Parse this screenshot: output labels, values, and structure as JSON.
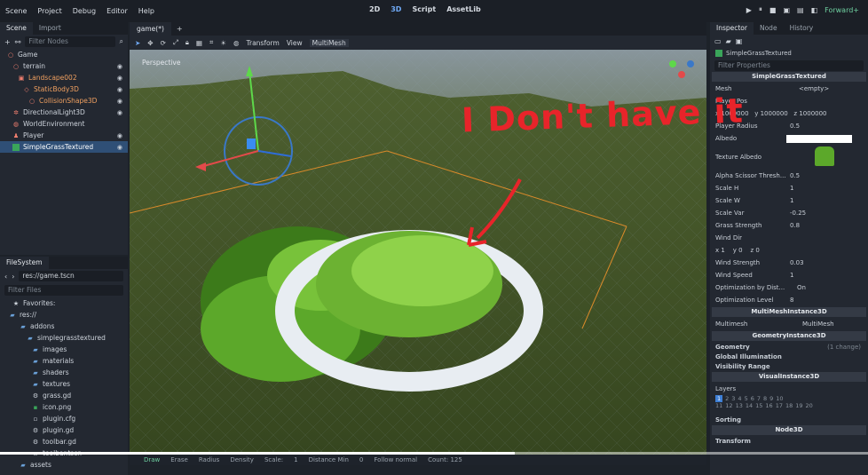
{
  "menu": [
    "Scene",
    "Project",
    "Debug",
    "Editor",
    "Help"
  ],
  "center_tabs": [
    "2D",
    "3D",
    "Script",
    "AssetLib"
  ],
  "renderer": "Forward+",
  "scene_panel": {
    "tabs": [
      "Scene",
      "Import"
    ],
    "filter_placeholder": "Filter Nodes",
    "nodes": [
      {
        "label": "Game",
        "depth": 0
      },
      {
        "label": "terrain",
        "depth": 1
      },
      {
        "label": "Landscape002",
        "depth": 2
      },
      {
        "label": "StaticBody3D",
        "depth": 3
      },
      {
        "label": "CollisionShape3D",
        "depth": 4
      },
      {
        "label": "DirectionalLight3D",
        "depth": 1
      },
      {
        "label": "WorldEnvironment",
        "depth": 1
      },
      {
        "label": "Player",
        "depth": 1
      },
      {
        "label": "SimpleGrassTextured",
        "depth": 1
      }
    ]
  },
  "filesystem": {
    "tab": "FileSystem",
    "path": "res://game.tscn",
    "filter_placeholder": "Filter Files",
    "items": [
      {
        "label": "Favorites:",
        "depth": 0
      },
      {
        "label": "res://",
        "depth": 0
      },
      {
        "label": "addons",
        "depth": 1
      },
      {
        "label": "simplegrasstextured",
        "depth": 2
      },
      {
        "label": "images",
        "depth": 3
      },
      {
        "label": "materials",
        "depth": 3
      },
      {
        "label": "shaders",
        "depth": 3
      },
      {
        "label": "textures",
        "depth": 3
      },
      {
        "label": "grass.gd",
        "depth": 3
      },
      {
        "label": "icon.png",
        "depth": 3
      },
      {
        "label": "plugin.cfg",
        "depth": 3
      },
      {
        "label": "plugin.gd",
        "depth": 3
      },
      {
        "label": "toolbar.gd",
        "depth": 3
      },
      {
        "label": "toolbar.tscn",
        "depth": 3
      },
      {
        "label": "assets",
        "depth": 1
      }
    ]
  },
  "viewport": {
    "tab": "game(*)",
    "toolbar": [
      "Transform",
      "View",
      "MultiMesh"
    ],
    "perspective": "Perspective",
    "bottom": {
      "draw": "Draw",
      "erase": "Erase",
      "radius": "Radius",
      "density": "Density",
      "scale": "Scale:",
      "scale_val": "1",
      "distance": "Distance Min",
      "distance_val": "0",
      "follow": "Follow normal",
      "count": "Count: 125"
    }
  },
  "annotation": "I Don't have it",
  "inspector": {
    "tabs": [
      "Inspector",
      "Node",
      "History"
    ],
    "node": "SimpleGrassTextured",
    "filter_placeholder": "Filter Properties",
    "section_main": "SimpleGrassTextured",
    "props": [
      {
        "k": "Mesh",
        "v": "<empty>"
      },
      {
        "k": "Player Pos",
        "v": ""
      },
      {
        "k": "",
        "v": "x 1000000   y 1000000   z 1000000"
      },
      {
        "k": "Player Radius",
        "v": "0.5"
      },
      {
        "k": "Albedo",
        "v": ""
      },
      {
        "k": "Texture Albedo",
        "v": ""
      },
      {
        "k": "Alpha Scissor Thresh...",
        "v": "0.5"
      },
      {
        "k": "Scale H",
        "v": "1"
      },
      {
        "k": "Scale W",
        "v": "1"
      },
      {
        "k": "Scale Var",
        "v": "-0.25"
      },
      {
        "k": "Grass Strength",
        "v": "0.8"
      },
      {
        "k": "Wind Dir",
        "v": ""
      },
      {
        "k": "",
        "v": "x 1    y 0    z 0"
      },
      {
        "k": "Wind Strength",
        "v": "0.03"
      },
      {
        "k": "Wind Speed",
        "v": "1"
      },
      {
        "k": "Optimization by Dist...",
        "v": "On"
      },
      {
        "k": "Optimization Level",
        "v": "8"
      }
    ],
    "section_mmi": "MultiMeshInstance3D",
    "multimesh_k": "Multimesh",
    "multimesh_v": "MultiMesh",
    "section_geo": "GeometryInstance3D",
    "geo_groups": [
      "Geometry",
      "Global Illumination",
      "Visibility Range"
    ],
    "geo_change": "(1 change)",
    "section_vis": "VisualInstance3D",
    "layers_label": "Layers",
    "layers_row1": [
      "1",
      "2",
      "3",
      "4",
      "5",
      "6",
      "7",
      "8",
      "9",
      "10"
    ],
    "layers_row2": [
      "11",
      "12",
      "13",
      "14",
      "15",
      "16",
      "17",
      "18",
      "19",
      "20"
    ],
    "sorting": "Sorting",
    "section_node": "Node3D",
    "transform": "Transform"
  },
  "colors": {
    "accent": "#3e7fd6",
    "annotation": "#e8242a",
    "selection": "#2f4f76"
  }
}
